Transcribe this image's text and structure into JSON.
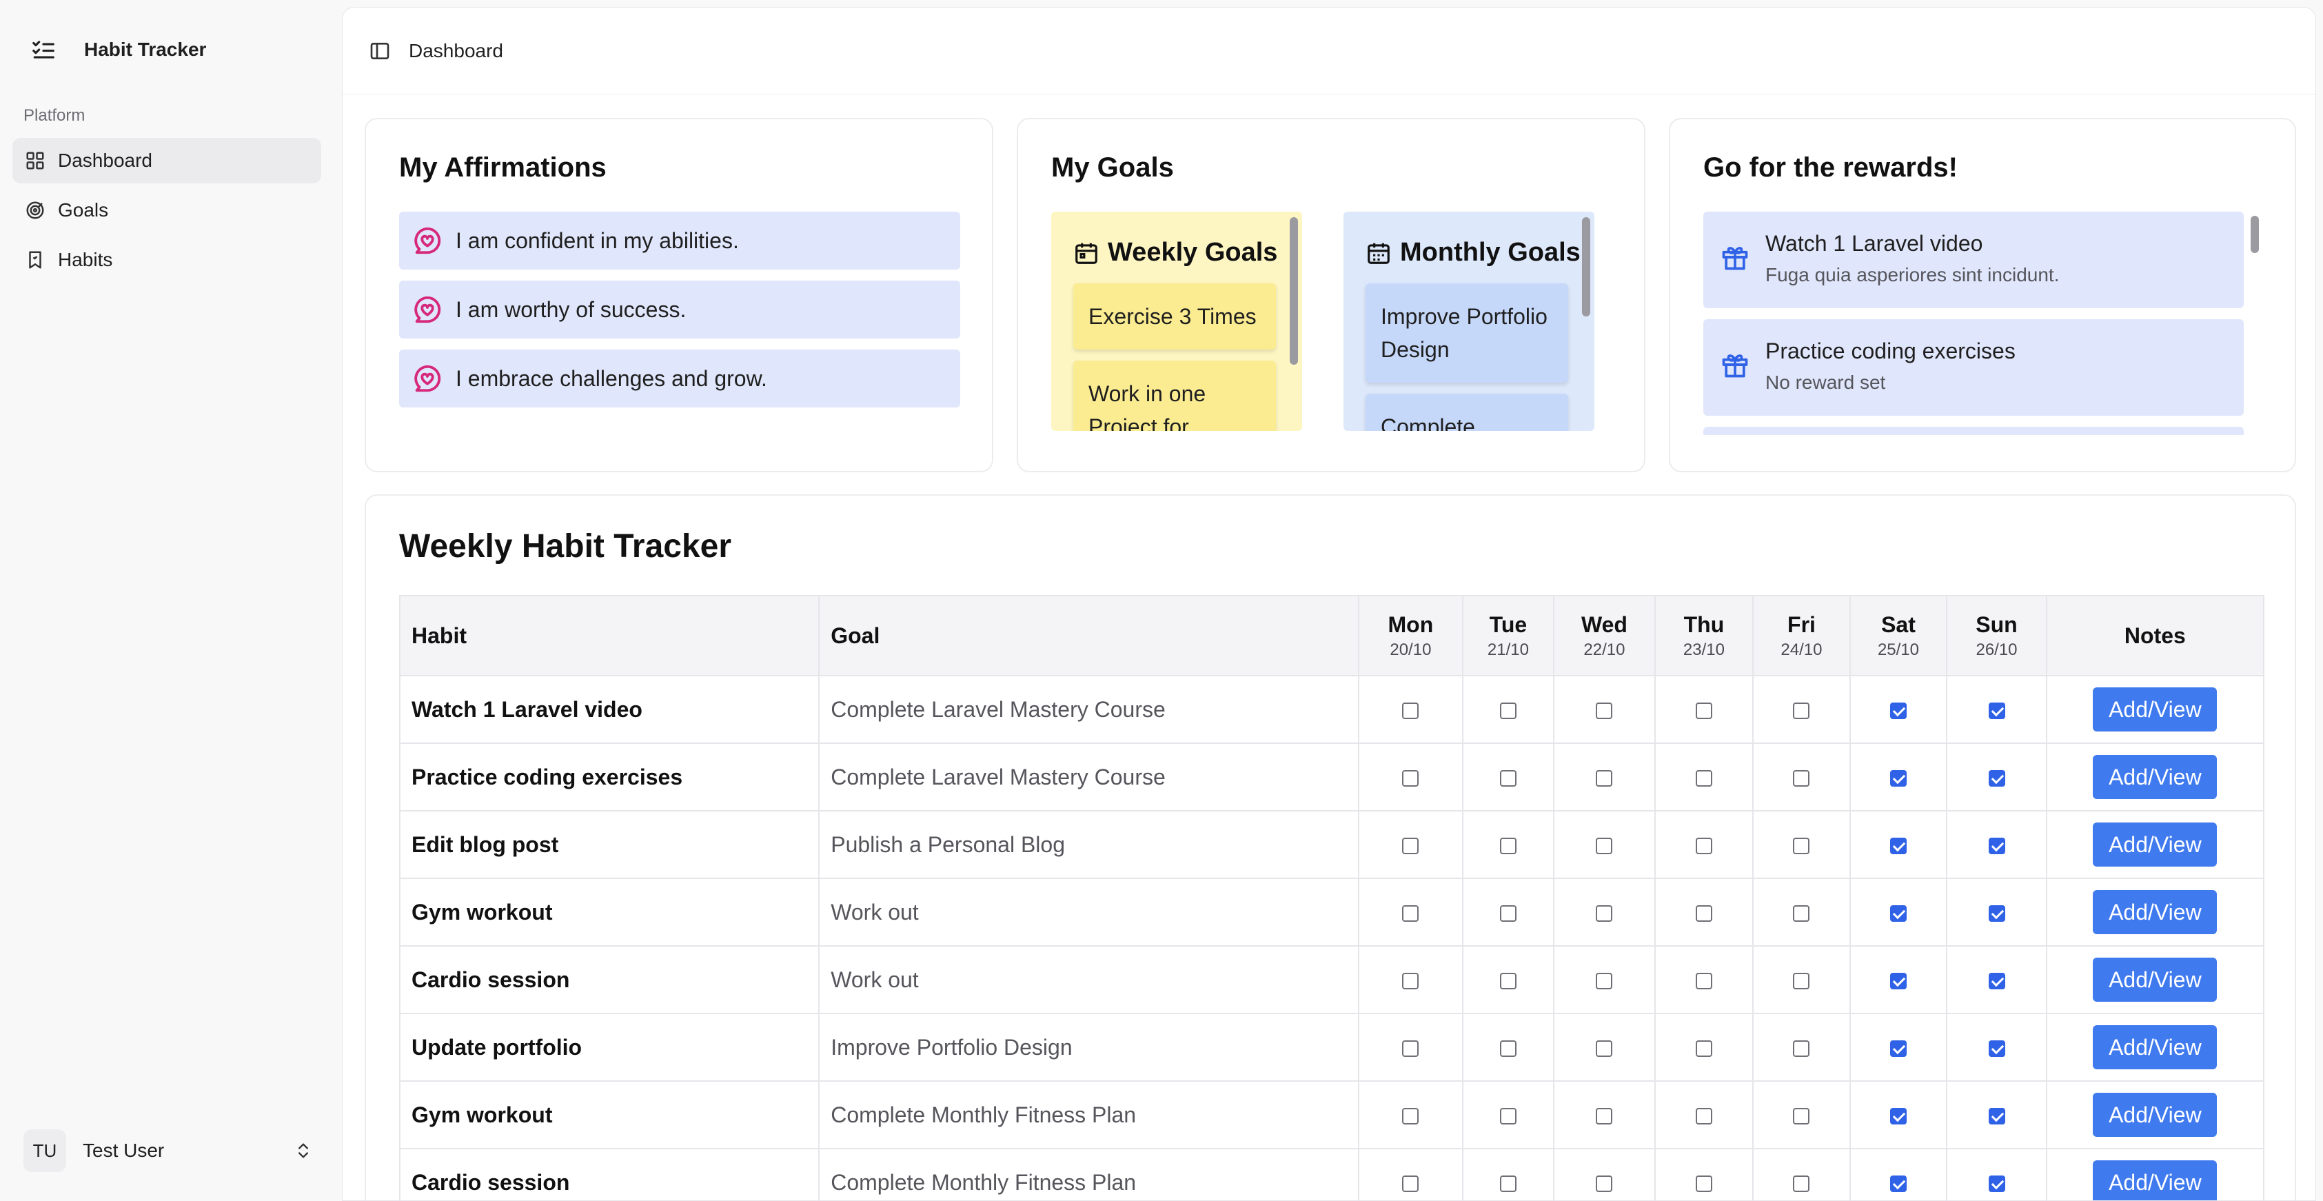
{
  "app": {
    "title": "Habit Tracker"
  },
  "sidebar": {
    "section_label": "Platform",
    "items": [
      {
        "label": "Dashboard",
        "icon": "grid-icon",
        "active": true
      },
      {
        "label": "Goals",
        "icon": "target-icon",
        "active": false
      },
      {
        "label": "Habits",
        "icon": "bookmark-icon",
        "active": false
      }
    ],
    "user": {
      "initials": "TU",
      "name": "Test User"
    }
  },
  "header": {
    "breadcrumb": "Dashboard"
  },
  "affirmations": {
    "title": "My Affirmations",
    "items": [
      "I am confident in my abilities.",
      "I am worthy of success.",
      "I embrace challenges and grow."
    ]
  },
  "goals": {
    "title": "My Goals",
    "weekly": {
      "label": "Weekly Goals",
      "items": [
        "Exercise 3 Times",
        "Work in one Project for"
      ]
    },
    "monthly": {
      "label": "Monthly Goals",
      "items": [
        "Improve Portfolio Design",
        "Complete"
      ]
    }
  },
  "rewards": {
    "title": "Go for the rewards!",
    "items": [
      {
        "title": "Watch 1 Laravel video",
        "subtitle": "Fuga quia asperiores sint incidunt."
      },
      {
        "title": "Practice coding exercises",
        "subtitle": "No reward set"
      }
    ]
  },
  "tracker": {
    "title": "Weekly Habit Tracker",
    "columns": {
      "habit": "Habit",
      "goal": "Goal",
      "notes": "Notes"
    },
    "days": [
      {
        "name": "Mon",
        "date": "20/10"
      },
      {
        "name": "Tue",
        "date": "21/10"
      },
      {
        "name": "Wed",
        "date": "22/10"
      },
      {
        "name": "Thu",
        "date": "23/10"
      },
      {
        "name": "Fri",
        "date": "24/10"
      },
      {
        "name": "Sat",
        "date": "25/10"
      },
      {
        "name": "Sun",
        "date": "26/10"
      }
    ],
    "notes_button": "Add/View",
    "rows": [
      {
        "habit": "Watch 1 Laravel video",
        "goal": "Complete Laravel Mastery Course",
        "checks": [
          false,
          false,
          false,
          false,
          false,
          true,
          true
        ]
      },
      {
        "habit": "Practice coding exercises",
        "goal": "Complete Laravel Mastery Course",
        "checks": [
          false,
          false,
          false,
          false,
          false,
          true,
          true
        ]
      },
      {
        "habit": "Edit blog post",
        "goal": "Publish a Personal Blog",
        "checks": [
          false,
          false,
          false,
          false,
          false,
          true,
          true
        ]
      },
      {
        "habit": "Gym workout",
        "goal": "Work out",
        "checks": [
          false,
          false,
          false,
          false,
          false,
          true,
          true
        ]
      },
      {
        "habit": "Cardio session",
        "goal": "Work out",
        "checks": [
          false,
          false,
          false,
          false,
          false,
          true,
          true
        ]
      },
      {
        "habit": "Update portfolio",
        "goal": "Improve Portfolio Design",
        "checks": [
          false,
          false,
          false,
          false,
          false,
          true,
          true
        ]
      },
      {
        "habit": "Gym workout",
        "goal": "Complete Monthly Fitness Plan",
        "checks": [
          false,
          false,
          false,
          false,
          false,
          true,
          true
        ]
      },
      {
        "habit": "Cardio session",
        "goal": "Complete Monthly Fitness Plan",
        "checks": [
          false,
          false,
          false,
          false,
          false,
          true,
          true
        ]
      }
    ]
  },
  "colors": {
    "accent": "#3f7aef",
    "affirmation_bg": "#e0e6fb",
    "weekly_bg": "#fdf6c3",
    "monthly_bg": "#dde8fb",
    "heart": "#d6287a"
  }
}
